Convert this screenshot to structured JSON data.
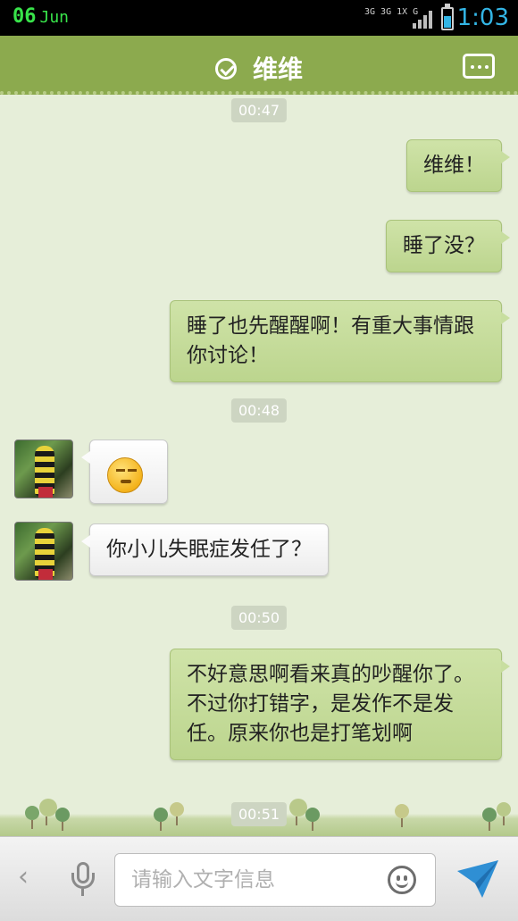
{
  "status_bar": {
    "date_day": "06",
    "date_month": "Jun",
    "network": "3G 3G 1X G",
    "time": "1:03"
  },
  "header": {
    "title": "维维",
    "verified_icon": "check-circle-icon",
    "more_icon": "more-dots-icon"
  },
  "messages": [
    {
      "type": "timestamp",
      "text": "00:47"
    },
    {
      "type": "out",
      "text": "维维！"
    },
    {
      "type": "out",
      "text": "睡了没？"
    },
    {
      "type": "out",
      "text": "睡了也先醒醒啊！有重大事情跟你讨论！"
    },
    {
      "type": "timestamp",
      "text": "00:48"
    },
    {
      "type": "in",
      "emoji": "grimace-emoji"
    },
    {
      "type": "in",
      "text": "你小儿失眠症发任了？"
    },
    {
      "type": "timestamp",
      "text": "00:50"
    },
    {
      "type": "out",
      "text": "不好意思啊看来真的吵醒你了。不过你打错字，是发作不是发任。原来你也是打笔划啊"
    },
    {
      "type": "timestamp",
      "text": "00:51"
    }
  ],
  "input_bar": {
    "placeholder": "请输入文字信息",
    "value": "",
    "icons": [
      "chevron-left-icon",
      "microphone-icon",
      "smiley-icon",
      "send-icon"
    ]
  },
  "colors": {
    "header_bg": "#8caa4e",
    "chat_bg": "#e6eed9",
    "out_bubble": "#c3da98",
    "in_bubble": "#f4f4f4",
    "status_time": "#33b5e5",
    "status_date": "#38e34a"
  }
}
